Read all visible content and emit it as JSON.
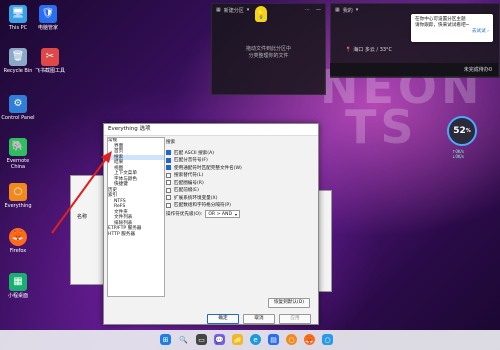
{
  "desktop": {
    "icons": [
      {
        "label": "This PC",
        "color": "#3aa0e8",
        "glyph": "🖥",
        "icon": "computer-icon"
      },
      {
        "label": "电脑管家",
        "color": "#2a6ef0",
        "glyph": "🛡",
        "icon": "shield-icon"
      },
      {
        "label": "Recycle Bin",
        "color": "#8aa8c8",
        "glyph": "🗑",
        "icon": "recycle-bin-icon"
      },
      {
        "label": "飞书截图工具",
        "color": "#e04848",
        "glyph": "✂",
        "icon": "screenshot-tool-icon"
      },
      {
        "label": "Control Panel",
        "color": "#2f7fd8",
        "glyph": "⚙",
        "icon": "control-panel-icon"
      },
      {
        "label": "Evernote China",
        "color": "#2dbe60",
        "glyph": "🐘",
        "icon": "evernote-icon"
      },
      {
        "label": "Everything",
        "color": "#f08a1c",
        "glyph": "○",
        "icon": "everything-icon"
      },
      {
        "label": "Firefox",
        "color": "#ff6a1a",
        "glyph": "🦊",
        "icon": "firefox-icon"
      },
      {
        "label": "小程桌面",
        "color": "#18b070",
        "glyph": "▦",
        "icon": "desktop-app-icon"
      }
    ],
    "wallpaper_text": [
      "NEON",
      "TS"
    ]
  },
  "widget_folder": {
    "title": "新建分区",
    "empty_text_line1": "拖动文件到此分区中",
    "empty_text_line2": "分类整理你的文件"
  },
  "widget_weather": {
    "title": "我的",
    "location": "海口 多云 / 33°C",
    "popup_line1": "在你中心可设置分区主题",
    "popup_line2": "请你跟踪，快来试试看吧~",
    "popup_action": "去试试 ›",
    "unfinished": "未完成待办 ",
    "unfinished_count": "0"
  },
  "gauge": {
    "value": "52",
    "unit": "%",
    "up": "0K/s",
    "down": "0K/s"
  },
  "bg_window": {
    "label": "名称"
  },
  "dialog": {
    "title": "Everything 选项",
    "tree": [
      "常规",
      "  界面",
      "  首页",
      "  搜索",
      "  结果",
      "  视图",
      "  上下文菜单",
      "  字体与颜色",
      "  快捷键",
      "历史",
      "索引",
      "  NTFS",
      "  ReFS",
      "  文件夹",
      "  文件列表",
      "  排除列表",
      "ETP/FTP 服务器",
      "HTTP 服务器"
    ],
    "panel_title": "搜索",
    "options": [
      {
        "label": "匹配 ASCII 搜索(A)",
        "checked": true
      },
      {
        "label": "匹配分音符号(F)",
        "checked": true
      },
      {
        "label": "使用通配符时匹配完整文件名(W)",
        "checked": true
      },
      {
        "label": "搜索替代符(L)",
        "checked": false
      },
      {
        "label": "匹配圈编号(R)",
        "checked": false
      },
      {
        "label": "匹配前缀(E)",
        "checked": false
      },
      {
        "label": "扩展系统环境变量(X)",
        "checked": false
      },
      {
        "label": "匹配数组和字符格分隔符(P)",
        "checked": false
      }
    ],
    "operator_label": "操作符优先级(O):",
    "operator_value": "OR > AND",
    "restore_button": "恢复到默认(D)",
    "ok_button": "确定",
    "cancel_button": "取消",
    "apply_button": "应用"
  },
  "colors": {
    "accent": "#1e66d0",
    "arrow": "#e02020"
  }
}
